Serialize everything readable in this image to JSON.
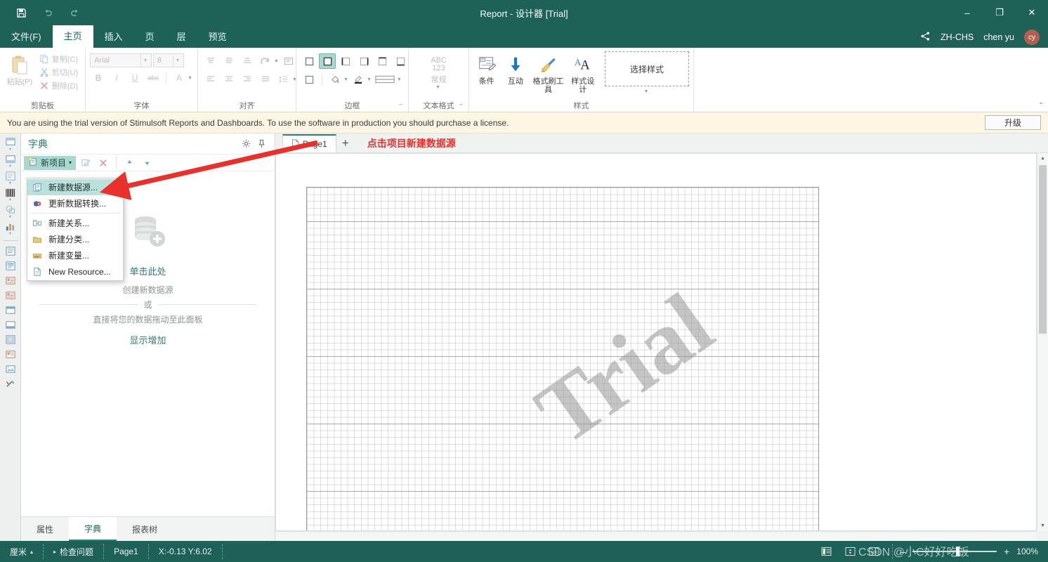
{
  "window": {
    "title": "Report - 设计器 [Trial]",
    "quick_access": [
      "save-icon",
      "undo-icon",
      "redo-icon"
    ],
    "controls": {
      "minimize": "–",
      "maximize": "❐",
      "close": "✕"
    }
  },
  "ribbon_tabs": [
    {
      "label": "文件(F)",
      "active": false
    },
    {
      "label": "主页",
      "active": true
    },
    {
      "label": "插入",
      "active": false
    },
    {
      "label": "页",
      "active": false
    },
    {
      "label": "层",
      "active": false
    },
    {
      "label": "预览",
      "active": false
    }
  ],
  "topbar_right": {
    "share_icon": "share-icon",
    "language": "ZH-CHS",
    "user_name": "chen yu",
    "avatar_initials": "cy"
  },
  "ribbon": {
    "collapse_caret": "⌃",
    "groups": [
      {
        "label": "剪贴板",
        "paste_label": "粘贴(P)",
        "items": [
          {
            "label": "复制(C)",
            "icon": "copy-icon"
          },
          {
            "label": "剪切(U)",
            "icon": "cut-icon"
          },
          {
            "label": "删除(D)",
            "icon": "delete-icon"
          }
        ]
      },
      {
        "label": "字体",
        "font_name": "Arial",
        "font_size": "8",
        "buttons": [
          "B",
          "I",
          "U",
          "abc",
          "A"
        ]
      },
      {
        "label": "对齐"
      },
      {
        "label": "边框",
        "dialog_launcher": "⌐"
      },
      {
        "label": "文本格式",
        "format_abc": "ABC",
        "format_123": "123",
        "format_name": "常规",
        "dialog_launcher": "⌐"
      },
      {
        "label": "样式",
        "buttons": [
          {
            "label": "条件",
            "icon": "condition-icon"
          },
          {
            "label": "互动",
            "icon": "interaction-icon"
          },
          {
            "label": "格式刷工具",
            "icon": "format-painter-icon"
          },
          {
            "label": "样式设计",
            "icon": "style-designer-icon"
          }
        ],
        "style_selector": "选择样式"
      }
    ]
  },
  "trial": {
    "message": "You are using the trial version of Stimulsoft Reports and Dashboards. To use the software in production you should purchase a license.",
    "upgrade_label": "升级"
  },
  "rail": {
    "top_items": [
      "band-icon",
      "data-band-icon",
      "header-band-icon",
      "barcode-icon",
      "shape-icon",
      "chart-icon"
    ],
    "bottom_items": [
      "text-component-icon",
      "rich-text-icon",
      "image-text-icon",
      "picture-box-icon",
      "panel-icon",
      "clone-panel-icon",
      "sub-report-icon",
      "checkbox-text-icon",
      "image-icon",
      "tools-icon"
    ]
  },
  "dictionary": {
    "title": "字典",
    "header_icons": [
      "gear-icon",
      "pin-icon"
    ],
    "toolbar": {
      "new_item_label": "新项目",
      "new_item_caret": "▾",
      "edit_icon": "edit-icon",
      "delete_icon": "delete-x-icon",
      "move_up_icon": "move-up-icon",
      "move_down_icon": "move-down-icon"
    },
    "empty_state": {
      "db_icon": "database-plus-icon",
      "click_here": "单击此处",
      "create_datasource": "创建新数据源",
      "or": "或",
      "drag_hint": "直接将您的数据拖动至此面板",
      "show_more": "显示增加"
    },
    "dock_tabs": [
      {
        "label": "属性",
        "active": false
      },
      {
        "label": "字典",
        "active": true
      },
      {
        "label": "报表树",
        "active": false
      }
    ]
  },
  "menu": {
    "items": [
      {
        "label": "新建数据源...",
        "icon": "new-datasource-icon",
        "highlighted": true
      },
      {
        "label": "更新数据转换...",
        "icon": "refresh-data-icon",
        "highlighted": false
      },
      {
        "label": "新建关系...",
        "icon": "new-relation-icon",
        "highlighted": false,
        "separator_before": true
      },
      {
        "label": "新建分类...",
        "icon": "new-category-icon",
        "highlighted": false
      },
      {
        "label": "新建变量...",
        "icon": "new-variable-icon",
        "highlighted": false
      },
      {
        "label": "New Resource...",
        "icon": "new-resource-icon",
        "highlighted": false
      }
    ]
  },
  "design": {
    "page_tab": {
      "label": "Page1",
      "icon": "page-icon"
    },
    "add_page": "+",
    "annotation": "点击项目新建数据源",
    "watermark": "Trial"
  },
  "status": {
    "unit": "厘米",
    "unit_caret": "▴",
    "check_issues": "检查问题",
    "check_issues_caret": "▸",
    "page": "Page1",
    "coords": "X:-0.13 Y:6.02",
    "view_icons": [
      "page-layout-icon",
      "page-fit-icon",
      "zoom-100-icon"
    ],
    "zoom_minus": "–",
    "zoom_plus": "+",
    "zoom_value": "100%",
    "watermark": "CSDN @小C好好吃饭"
  },
  "colors": {
    "brand_dark": "#1d6157",
    "accent_teal": "#2d7d70",
    "highlight": "#a8d8d0",
    "trial_bg": "#fdf6e3",
    "annotation_red": "#e8312c",
    "avatar_bg": "#b0604f"
  }
}
